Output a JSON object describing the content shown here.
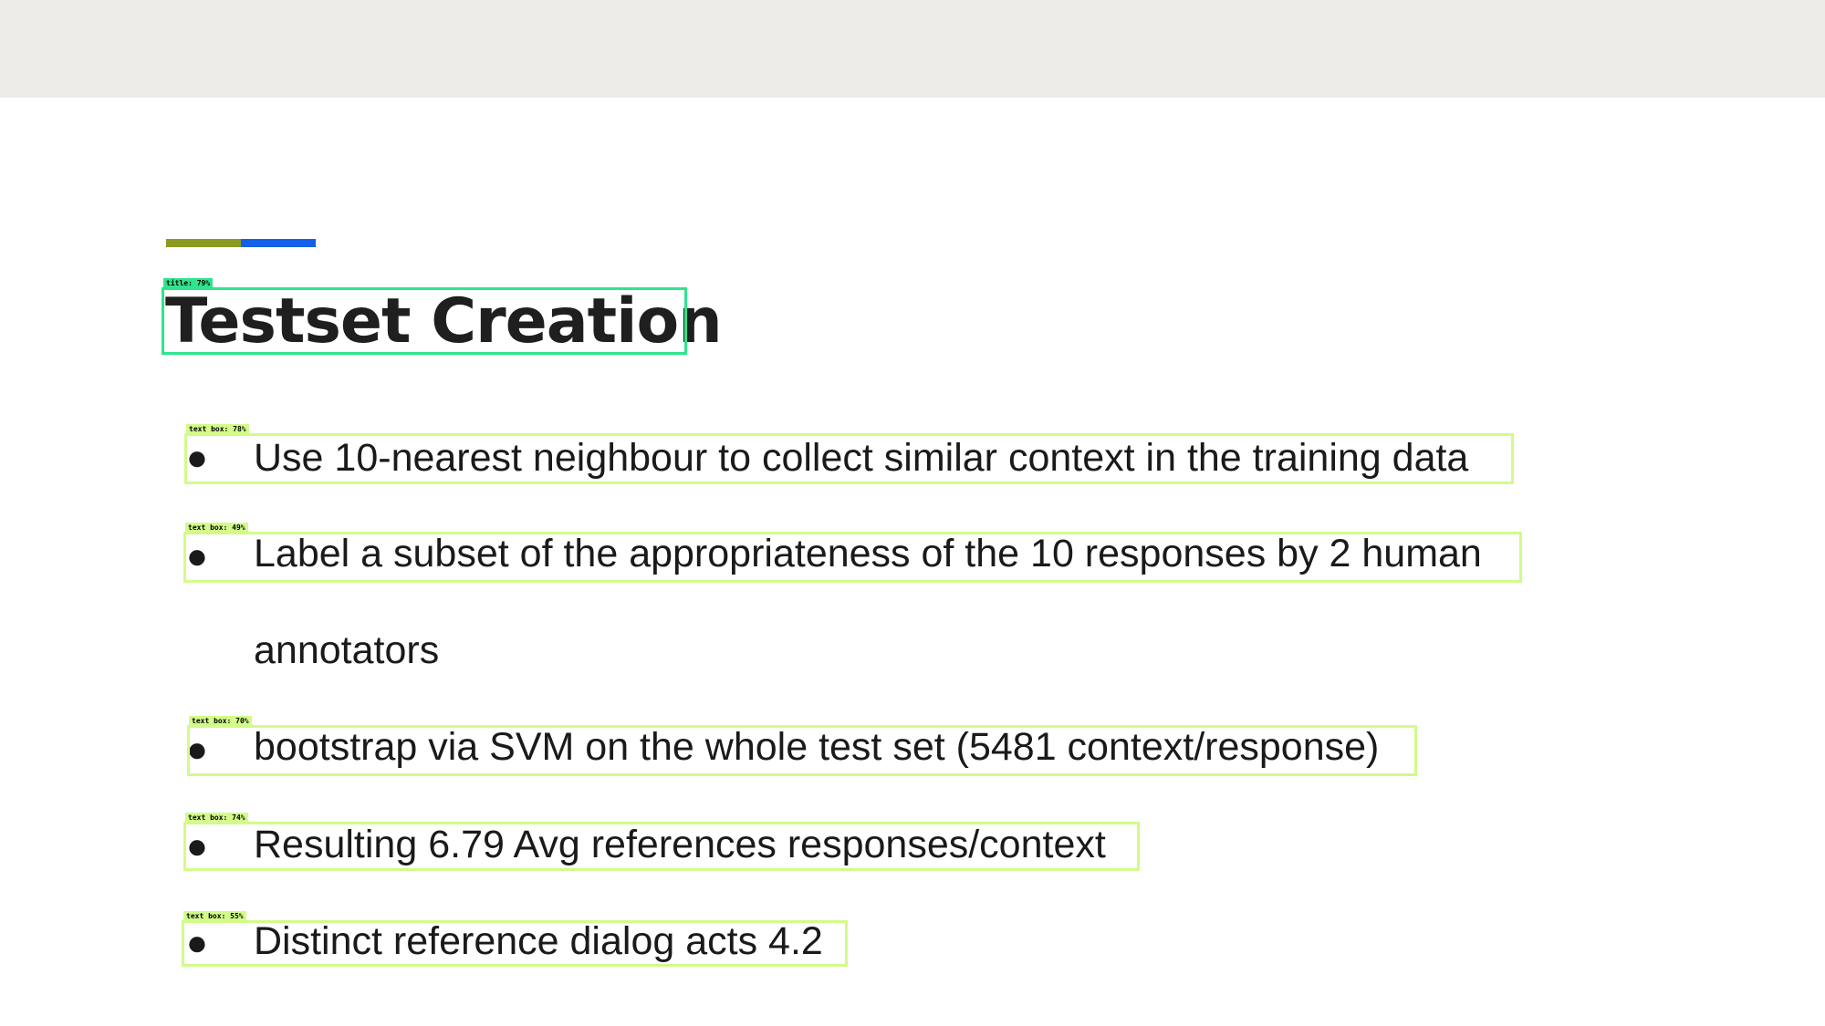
{
  "slide": {
    "title": "Testset Creation",
    "accent_colors": {
      "olive": "#8c9a23",
      "blue": "#1560e8"
    },
    "bullet_glyph": "●",
    "bullets": [
      {
        "text": "Use 10-nearest neighbour to collect similar context in the training data"
      },
      {
        "text": "Label a subset of the appropriateness of the 10 responses by 2 human",
        "continuation": "annotators"
      },
      {
        "text": "bootstrap via SVM on the whole test set (5481 context/response)"
      },
      {
        "text": "Resulting 6.79 Avg references responses/context"
      },
      {
        "text": "Distinct reference dialog acts 4.2"
      }
    ]
  },
  "detections": {
    "box_colors": {
      "title": "#2ee58c",
      "text_box": "#d2fb8a"
    },
    "labels": [
      "title: 79%",
      "text box: 78%",
      "text box: 49%",
      "text box: 70%",
      "text box: 74%",
      "text box: 55%"
    ]
  }
}
